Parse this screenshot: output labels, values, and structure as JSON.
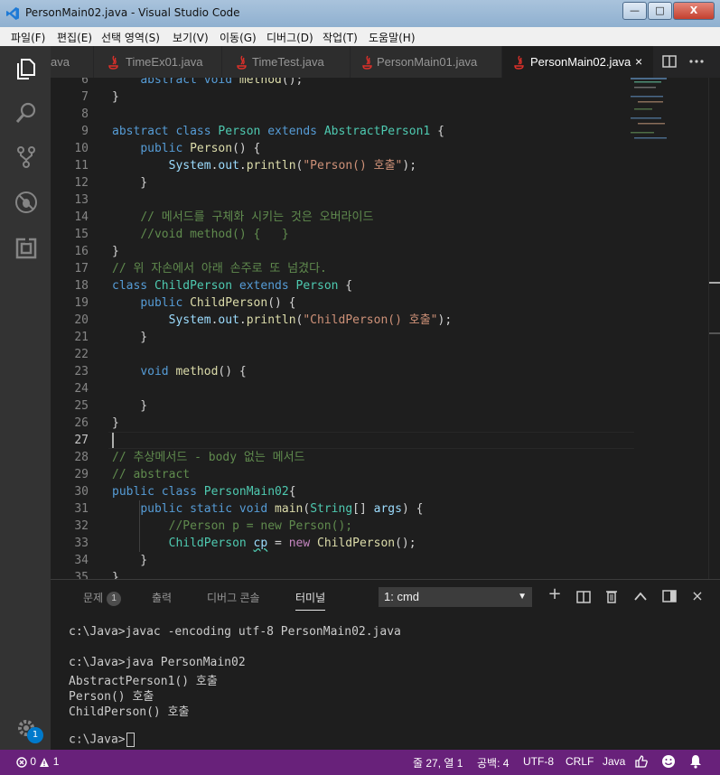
{
  "window": {
    "title": "PersonMain02.java - Visual Studio Code",
    "controls": {
      "minimize": "—",
      "maximize": "□",
      "close": "X"
    }
  },
  "menu": [
    "파일(F)",
    "편집(E)",
    "선택 영역(S)",
    "보기(V)",
    "이동(G)",
    "디버그(D)",
    "작업(T)",
    "도움말(H)"
  ],
  "tabs": [
    {
      "label": "ava",
      "active": false
    },
    {
      "label": "TimeEx01.java",
      "active": false
    },
    {
      "label": "TimeTest.java",
      "active": false
    },
    {
      "label": "PersonMain01.java",
      "active": false
    },
    {
      "label": "PersonMain02.java",
      "active": true,
      "close": "×"
    }
  ],
  "editor": {
    "current_line": 27,
    "lines": [
      {
        "n": 6,
        "tokens": [
          [
            "p",
            "    "
          ],
          [
            "k",
            "abstract"
          ],
          [
            "p",
            " "
          ],
          [
            "k",
            "void"
          ],
          [
            "p",
            " "
          ],
          [
            "f",
            "method"
          ],
          [
            "p",
            "();"
          ]
        ]
      },
      {
        "n": 7,
        "tokens": [
          [
            "p",
            "}"
          ]
        ]
      },
      {
        "n": 8,
        "tokens": []
      },
      {
        "n": 9,
        "tokens": [
          [
            "k",
            "abstract"
          ],
          [
            "p",
            " "
          ],
          [
            "k",
            "class"
          ],
          [
            "p",
            " "
          ],
          [
            "t",
            "Person"
          ],
          [
            "p",
            " "
          ],
          [
            "k",
            "extends"
          ],
          [
            "p",
            " "
          ],
          [
            "t",
            "AbstractPerson1"
          ],
          [
            "p",
            " {"
          ]
        ]
      },
      {
        "n": 10,
        "tokens": [
          [
            "p",
            "    "
          ],
          [
            "k",
            "public"
          ],
          [
            "p",
            " "
          ],
          [
            "f",
            "Person"
          ],
          [
            "p",
            "() {"
          ]
        ]
      },
      {
        "n": 11,
        "tokens": [
          [
            "p",
            "        "
          ],
          [
            "v",
            "System"
          ],
          [
            "p",
            "."
          ],
          [
            "v",
            "out"
          ],
          [
            "p",
            "."
          ],
          [
            "f",
            "println"
          ],
          [
            "p",
            "("
          ],
          [
            "s",
            "\"Person() 호출\""
          ],
          [
            "p",
            ");"
          ]
        ]
      },
      {
        "n": 12,
        "tokens": [
          [
            "p",
            "    }"
          ]
        ]
      },
      {
        "n": 13,
        "tokens": []
      },
      {
        "n": 14,
        "tokens": [
          [
            "p",
            "    "
          ],
          [
            "c",
            "// 메서드를 구체화 시키는 것은 오버라이드"
          ]
        ]
      },
      {
        "n": 15,
        "tokens": [
          [
            "p",
            "    "
          ],
          [
            "c",
            "//void method() {   }"
          ]
        ]
      },
      {
        "n": 16,
        "tokens": [
          [
            "p",
            "}"
          ]
        ]
      },
      {
        "n": 17,
        "tokens": [
          [
            "c",
            "// 위 자손에서 아래 손주로 또 넘겼다."
          ]
        ]
      },
      {
        "n": 18,
        "tokens": [
          [
            "k",
            "class"
          ],
          [
            "p",
            " "
          ],
          [
            "t",
            "ChildPerson"
          ],
          [
            "p",
            " "
          ],
          [
            "k",
            "extends"
          ],
          [
            "p",
            " "
          ],
          [
            "t",
            "Person"
          ],
          [
            "p",
            " {"
          ]
        ]
      },
      {
        "n": 19,
        "tokens": [
          [
            "p",
            "    "
          ],
          [
            "k",
            "public"
          ],
          [
            "p",
            " "
          ],
          [
            "f",
            "ChildPerson"
          ],
          [
            "p",
            "() {"
          ]
        ]
      },
      {
        "n": 20,
        "tokens": [
          [
            "p",
            "        "
          ],
          [
            "v",
            "System"
          ],
          [
            "p",
            "."
          ],
          [
            "v",
            "out"
          ],
          [
            "p",
            "."
          ],
          [
            "f",
            "println"
          ],
          [
            "p",
            "("
          ],
          [
            "s",
            "\"ChildPerson() 호출\""
          ],
          [
            "p",
            ");"
          ]
        ]
      },
      {
        "n": 21,
        "tokens": [
          [
            "p",
            "    }"
          ]
        ]
      },
      {
        "n": 22,
        "tokens": []
      },
      {
        "n": 23,
        "tokens": [
          [
            "p",
            "    "
          ],
          [
            "k",
            "void"
          ],
          [
            "p",
            " "
          ],
          [
            "f",
            "method"
          ],
          [
            "p",
            "() {"
          ]
        ]
      },
      {
        "n": 24,
        "tokens": []
      },
      {
        "n": 25,
        "tokens": [
          [
            "p",
            "    }"
          ]
        ]
      },
      {
        "n": 26,
        "tokens": [
          [
            "p",
            "}"
          ]
        ]
      },
      {
        "n": 27,
        "tokens": []
      },
      {
        "n": 28,
        "tokens": [
          [
            "c",
            "// 추상메서드 - body 없는 메서드"
          ]
        ]
      },
      {
        "n": 29,
        "tokens": [
          [
            "c",
            "// abstract"
          ]
        ]
      },
      {
        "n": 30,
        "tokens": [
          [
            "k",
            "public"
          ],
          [
            "p",
            " "
          ],
          [
            "k",
            "class"
          ],
          [
            "p",
            " "
          ],
          [
            "t",
            "PersonMain02"
          ],
          [
            "p",
            "{"
          ]
        ]
      },
      {
        "n": 31,
        "tokens": [
          [
            "p",
            "    "
          ],
          [
            "k",
            "public"
          ],
          [
            "p",
            " "
          ],
          [
            "k",
            "static"
          ],
          [
            "p",
            " "
          ],
          [
            "k",
            "void"
          ],
          [
            "p",
            " "
          ],
          [
            "f",
            "main"
          ],
          [
            "p",
            "("
          ],
          [
            "t",
            "String"
          ],
          [
            "p",
            "[] "
          ],
          [
            "v",
            "args"
          ],
          [
            "p",
            ") {"
          ]
        ]
      },
      {
        "n": 32,
        "tokens": [
          [
            "p",
            "        "
          ],
          [
            "c",
            "//Person p = new Person();"
          ]
        ]
      },
      {
        "n": 33,
        "tokens": [
          [
            "p",
            "        "
          ],
          [
            "t",
            "ChildPerson"
          ],
          [
            "p",
            " "
          ],
          [
            "v",
            "cp"
          ],
          [
            "p",
            " = "
          ],
          [
            "kw2",
            "new"
          ],
          [
            "p",
            " "
          ],
          [
            "f",
            "ChildPerson"
          ],
          [
            "p",
            "();"
          ]
        ]
      },
      {
        "n": 34,
        "tokens": [
          [
            "p",
            "    }"
          ]
        ]
      },
      {
        "n": 35,
        "tokens": [
          [
            "p",
            "}"
          ]
        ]
      }
    ]
  },
  "panel": {
    "tabs": [
      {
        "label": "문제",
        "badge": "1"
      },
      {
        "label": "출력"
      },
      {
        "label": "디버그 콘솔"
      },
      {
        "label": "터미널",
        "active": true
      }
    ],
    "terminal_select": "1: cmd",
    "actions": {
      "add": "+",
      "split": "◫",
      "kill": "🗑",
      "maximize": "^",
      "layout": "▣",
      "close": "×"
    },
    "terminal_lines": [
      "c:\\Java>javac -encoding utf-8 PersonMain02.java",
      "",
      "c:\\Java>java PersonMain02",
      "AbstractPerson1() 호출",
      "Person() 호출",
      "ChildPerson() 호출",
      "",
      "c:\\Java>"
    ]
  },
  "statusbar": {
    "errors": "0",
    "warnings": "1",
    "position": "줄 27, 열 1",
    "spaces": "공백: 4",
    "encoding": "UTF-8",
    "eol": "CRLF",
    "language": "Java"
  },
  "activity_badge": "1",
  "colors": {
    "status_bg": "#68217a",
    "editor_bg": "#1e1e1e",
    "accent": "#007acc"
  }
}
